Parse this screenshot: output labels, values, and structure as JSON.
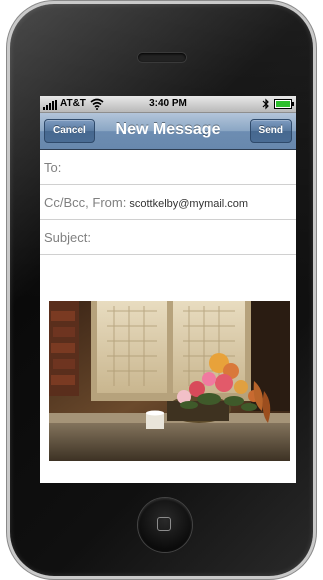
{
  "status_bar": {
    "carrier": "AT&T",
    "time": "3:40 PM"
  },
  "nav": {
    "title": "New Message",
    "cancel_label": "Cancel",
    "send_label": "Send"
  },
  "fields": {
    "to_label": "To:",
    "cc_label": "Cc/Bcc, From:",
    "from_value": "scottkelby@mymail.com",
    "subject_label": "Subject:"
  },
  "icons": {
    "signal": "signal-bars-icon",
    "wifi": "wifi-icon",
    "bluetooth": "bluetooth-icon",
    "battery": "battery-icon"
  },
  "colors": {
    "nav_bar": "#6d8db2",
    "nav_button": "#4a6c94",
    "field_label": "#808080",
    "battery_fill": "#2dbf2d"
  }
}
